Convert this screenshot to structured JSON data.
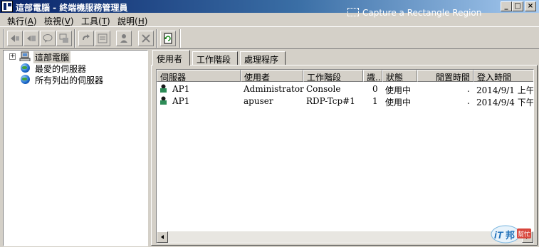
{
  "window": {
    "title": "這部電腦 - 終端機服務管理員",
    "capture_hint": "Capture a Rectangle Region",
    "minimize": "_",
    "maximize": "□",
    "close": "×"
  },
  "menu": [
    {
      "label": "執行(",
      "key": "A",
      "end": ")"
    },
    {
      "label": "檢視(",
      "key": "V",
      "end": ")"
    },
    {
      "label": "工具(",
      "key": "T",
      "end": ")"
    },
    {
      "label": "說明(",
      "key": "H",
      "end": ")"
    }
  ],
  "tree": {
    "items": [
      {
        "label": "這部電腦",
        "expander": "+"
      },
      {
        "label": "最愛的伺服器"
      },
      {
        "label": "所有列出的伺服器"
      }
    ]
  },
  "tabs": [
    {
      "label": "使用者"
    },
    {
      "label": "工作階段"
    },
    {
      "label": "處理程序"
    }
  ],
  "table": {
    "columns": [
      "伺服器",
      "使用者",
      "工作階段",
      "識...",
      "狀態",
      "閒置時間",
      "登入時間"
    ],
    "rows": [
      {
        "server": "AP1",
        "user": "Administrator",
        "session": "Console",
        "id": "0",
        "state": "使用中",
        "idle": ".",
        "logon": "2014/9/1 上午..."
      },
      {
        "server": "AP1",
        "user": "apuser",
        "session": "RDP-Tcp#1",
        "id": "1",
        "state": "使用中",
        "idle": ".",
        "logon": "2014/9/4 下午..."
      }
    ]
  },
  "watermark": {
    "text1": "iT",
    "text2": "邦",
    "text3": "幫忙"
  }
}
